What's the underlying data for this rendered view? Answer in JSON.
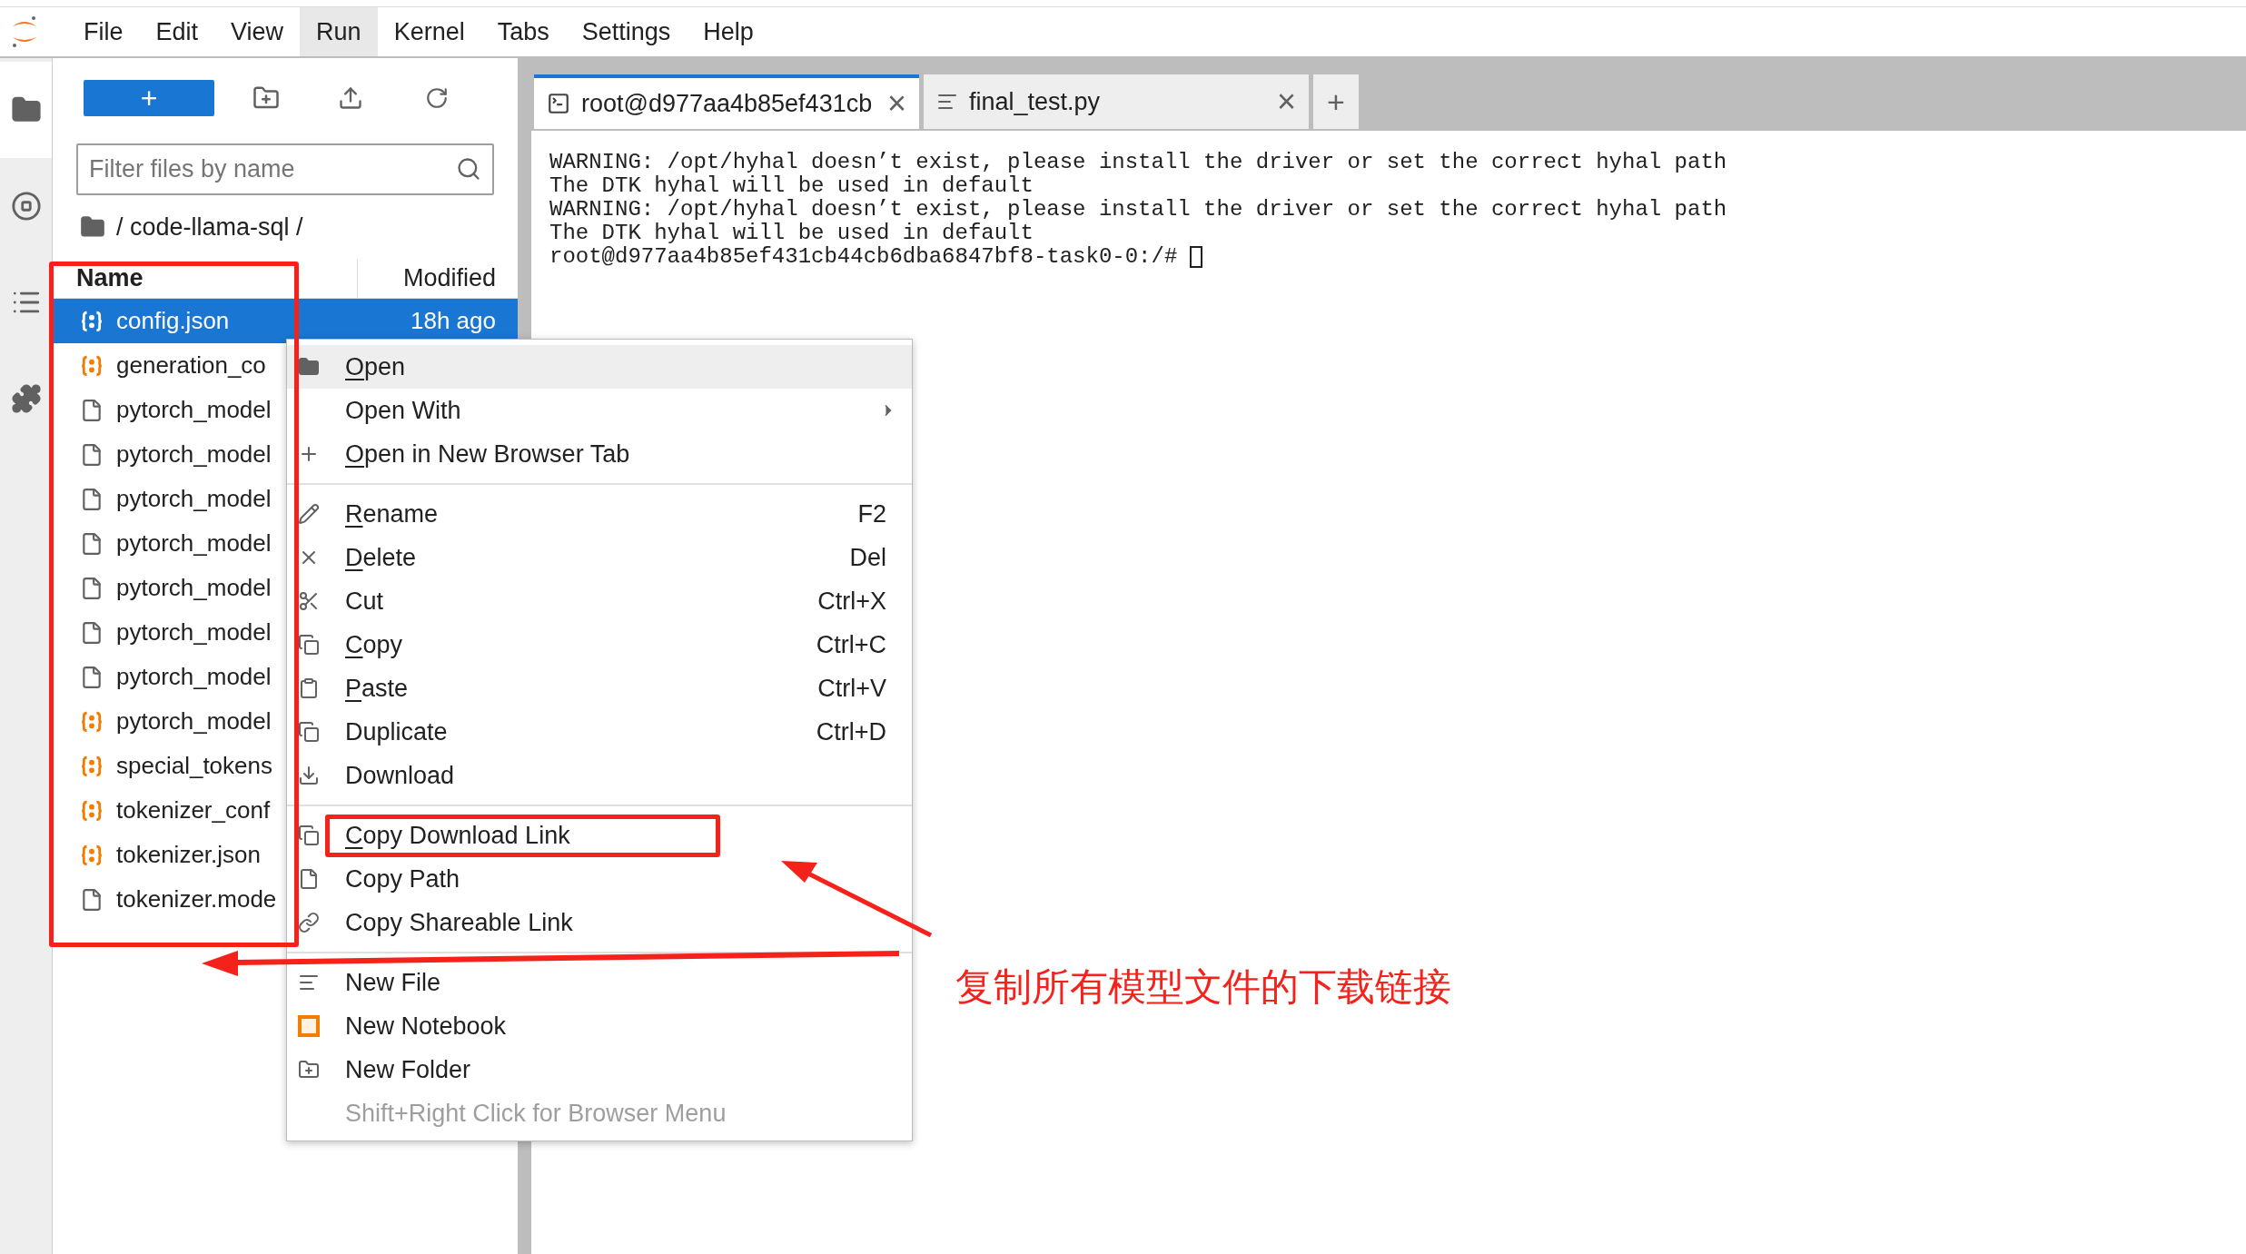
{
  "menu_bar": [
    {
      "label": "File",
      "selected": false
    },
    {
      "label": "Edit",
      "selected": false
    },
    {
      "label": "View",
      "selected": false
    },
    {
      "label": "Run",
      "selected": true
    },
    {
      "label": "Kernel",
      "selected": false
    },
    {
      "label": "Tabs",
      "selected": false
    },
    {
      "label": "Settings",
      "selected": false
    },
    {
      "label": "Help",
      "selected": false
    }
  ],
  "activity_bar": [
    {
      "selected": true
    },
    {
      "selected": false
    },
    {
      "selected": false
    },
    {
      "selected": false
    }
  ],
  "file_browser": {
    "new_button": "+",
    "filter": {
      "placeholder": "Filter files by name"
    },
    "breadcrumb": "/ code-llama-sql /",
    "columns": [
      "Name",
      "Modified"
    ],
    "rows": [
      {
        "name": "config.json",
        "kind": "json",
        "selected": true,
        "modified": "18h ago"
      },
      {
        "name": "generation_co",
        "kind": "json",
        "selected": false
      },
      {
        "name": "pytorch_model",
        "kind": "file",
        "selected": false
      },
      {
        "name": "pytorch_model",
        "kind": "file",
        "selected": false
      },
      {
        "name": "pytorch_model",
        "kind": "file",
        "selected": false
      },
      {
        "name": "pytorch_model",
        "kind": "file",
        "selected": false
      },
      {
        "name": "pytorch_model",
        "kind": "file",
        "selected": false
      },
      {
        "name": "pytorch_model",
        "kind": "file",
        "selected": false
      },
      {
        "name": "pytorch_model",
        "kind": "file",
        "selected": false
      },
      {
        "name": "pytorch_model",
        "kind": "json",
        "selected": false
      },
      {
        "name": "special_tokens",
        "kind": "json",
        "selected": false
      },
      {
        "name": "tokenizer_conf",
        "kind": "json",
        "selected": false
      },
      {
        "name": "tokenizer.json",
        "kind": "json",
        "selected": false
      },
      {
        "name": "tokenizer.mode",
        "kind": "file",
        "selected": false
      }
    ]
  },
  "tabs": [
    {
      "label": "root@d977aa4b85ef431cb",
      "kind": "terminal",
      "selected": true,
      "close": "×"
    },
    {
      "label": "final_test.py",
      "kind": "file",
      "selected": false,
      "close": "×"
    }
  ],
  "add_tab": "+",
  "terminal": {
    "lines": [
      "WARNING: /opt/hyhal doesn’t exist, please install the driver or set the correct hyhal path",
      "The DTK hyhal will be used in default",
      "WARNING: /opt/hyhal doesn’t exist, please install the driver or set the correct hyhal path",
      "The DTK hyhal will be used in default"
    ],
    "prompt": "root@d977aa4b85ef431cb44cb6dba6847bf8-task0-0:/#"
  },
  "context_menu": {
    "sections": [
      [
        {
          "label": "Open",
          "mnemonic": true,
          "hovered": true,
          "submenu": false
        },
        {
          "label": "Open With",
          "mnemonic": false,
          "hovered": false,
          "submenu": true
        },
        {
          "label": "Open in New Browser Tab",
          "mnemonic": true,
          "hovered": false,
          "submenu": false
        }
      ],
      [
        {
          "label": "Rename",
          "mnemonic": true,
          "hovered": false,
          "submenu": false,
          "shortcut": "F2"
        },
        {
          "label": "Delete",
          "mnemonic": true,
          "hovered": false,
          "submenu": false,
          "shortcut": "Del"
        },
        {
          "label": "Cut",
          "mnemonic": false,
          "hovered": false,
          "submenu": false,
          "shortcut": "Ctrl+X"
        },
        {
          "label": "Copy",
          "mnemonic": true,
          "hovered": false,
          "submenu": false,
          "shortcut": "Ctrl+C"
        },
        {
          "label": "Paste",
          "mnemonic": true,
          "hovered": false,
          "submenu": false,
          "shortcut": "Ctrl+V"
        },
        {
          "label": "Duplicate",
          "mnemonic": false,
          "hovered": false,
          "submenu": false,
          "shortcut": "Ctrl+D"
        },
        {
          "label": "Download",
          "mnemonic": false,
          "hovered": false,
          "submenu": false
        }
      ],
      [
        {
          "label": "Copy Download Link",
          "mnemonic": true,
          "hovered": false,
          "submenu": false,
          "highlighted": true
        },
        {
          "label": "Copy Path",
          "mnemonic": false,
          "hovered": false,
          "submenu": false
        },
        {
          "label": "Copy Shareable Link",
          "mnemonic": false,
          "hovered": false,
          "submenu": false
        }
      ],
      [
        {
          "label": "New File",
          "mnemonic": false,
          "hovered": false,
          "submenu": false
        },
        {
          "label": "New Notebook",
          "mnemonic": false,
          "hovered": false,
          "submenu": false
        },
        {
          "label": "New Folder",
          "mnemonic": false,
          "hovered": false,
          "submenu": false
        }
      ]
    ],
    "hint": "Shift+Right Click for Browser Menu"
  },
  "annotation": {
    "text": "复制所有模型文件的下载链接"
  }
}
